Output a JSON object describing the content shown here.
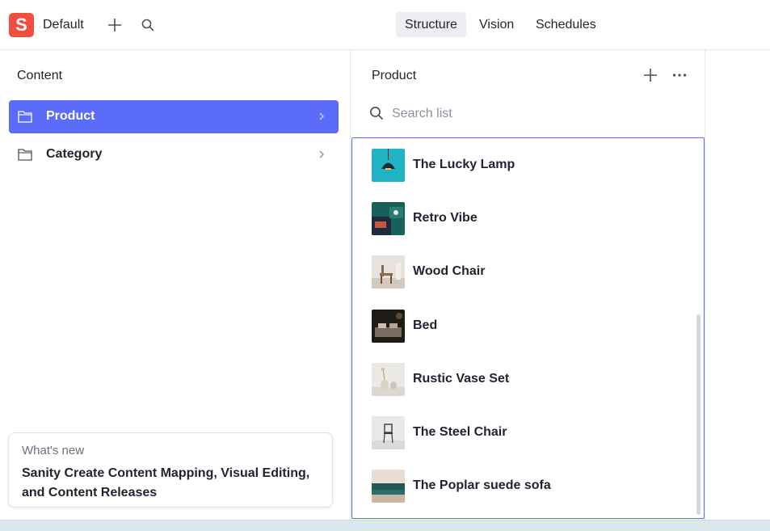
{
  "topbar": {
    "logo_letter": "S",
    "workspace": "Default",
    "tools": [
      "Structure",
      "Vision",
      "Schedules"
    ],
    "active_tool": "Structure"
  },
  "content_pane": {
    "title": "Content",
    "items": [
      {
        "label": "Product",
        "active": true
      },
      {
        "label": "Category",
        "active": false
      }
    ]
  },
  "whats_new": {
    "label": "What's new",
    "text": "Sanity Create Content Mapping, Visual Editing, and Content Releases"
  },
  "list_pane": {
    "title": "Product",
    "search_placeholder": "Search list",
    "search_value": "",
    "items": [
      {
        "name": "The Lucky Lamp",
        "thumb": "lamp-thumbnail"
      },
      {
        "name": "Retro Vibe",
        "thumb": "retro-thumbnail"
      },
      {
        "name": "Wood Chair",
        "thumb": "wood-chair-thumbnail"
      },
      {
        "name": "Bed",
        "thumb": "bed-thumbnail"
      },
      {
        "name": "Rustic Vase Set",
        "thumb": "vase-thumbnail"
      },
      {
        "name": "The Steel Chair",
        "thumb": "steel-chair-thumbnail"
      },
      {
        "name": "The Poplar suede sofa",
        "thumb": "sofa-thumbnail"
      }
    ]
  },
  "colors": {
    "brand": "#f04e3f",
    "accent": "#5a6cf8"
  }
}
